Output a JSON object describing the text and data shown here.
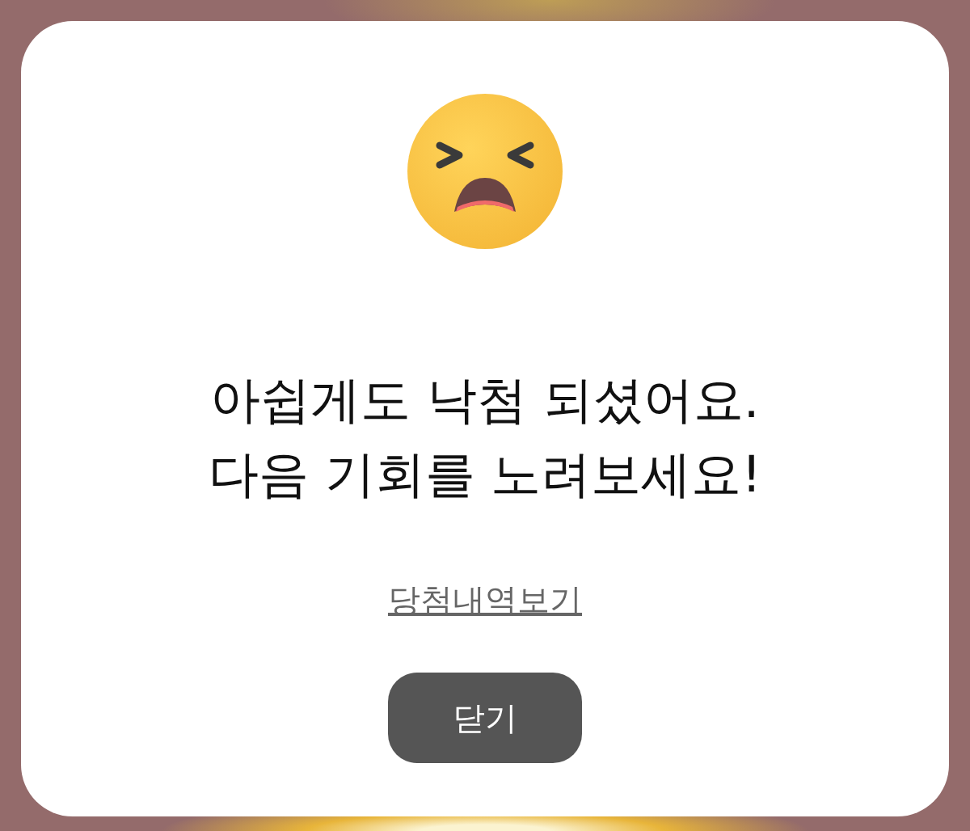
{
  "dialog": {
    "message": "아쉽게도 낙첨 되셨어요.\n다음 기회를 노려보세요!",
    "link": "당첨내역보기",
    "button": "닫기"
  }
}
